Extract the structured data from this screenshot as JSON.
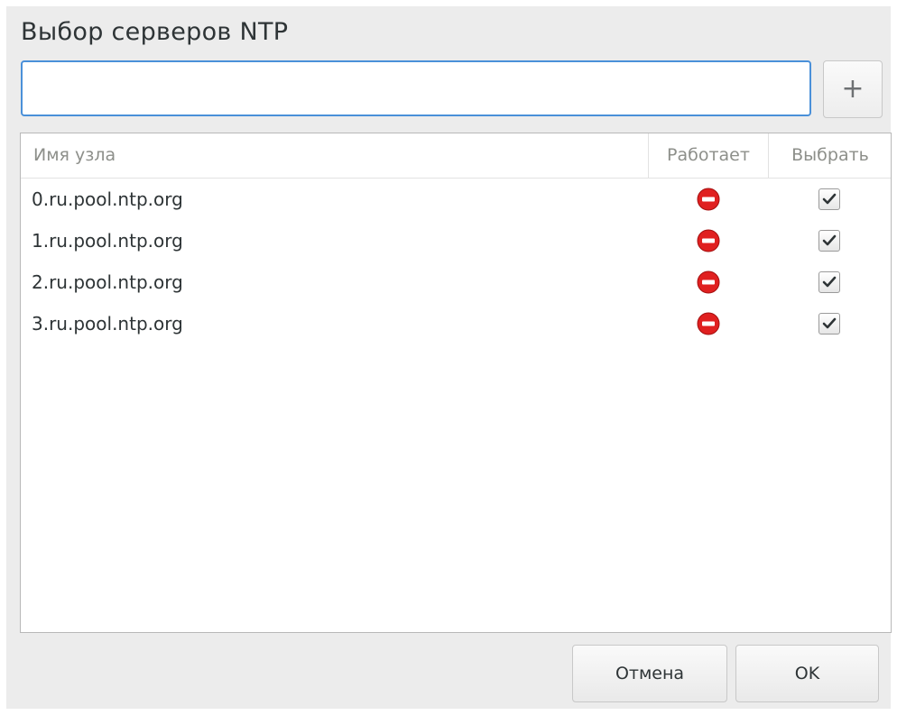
{
  "dialog": {
    "title": "Выбор серверов NTP"
  },
  "entry": {
    "value": "",
    "placeholder": ""
  },
  "add_button": {
    "label": "+"
  },
  "list": {
    "columns": {
      "host": "Имя узла",
      "working": "Работает",
      "select": "Выбрать"
    },
    "rows": [
      {
        "host": "0.ru.pool.ntp.org",
        "status_icon": "not-working-icon",
        "selected": true
      },
      {
        "host": "1.ru.pool.ntp.org",
        "status_icon": "not-working-icon",
        "selected": true
      },
      {
        "host": "2.ru.pool.ntp.org",
        "status_icon": "not-working-icon",
        "selected": true
      },
      {
        "host": "3.ru.pool.ntp.org",
        "status_icon": "not-working-icon",
        "selected": true
      }
    ]
  },
  "buttons": {
    "cancel": "Отмена",
    "ok": "OK"
  },
  "colors": {
    "status_not_working": "#e02020",
    "focus_border": "#4a90d9"
  }
}
